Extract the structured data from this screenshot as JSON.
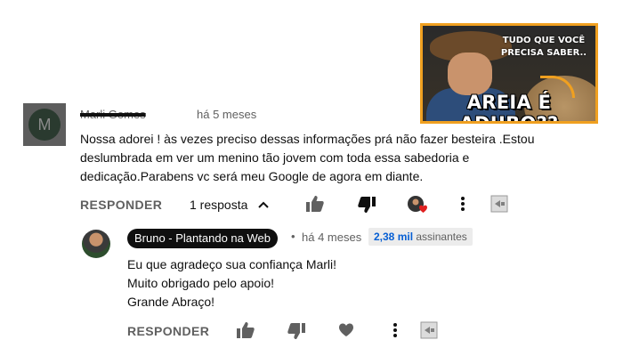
{
  "thumbnail": {
    "top_text_line1": "TUDO QUE VOCÊ",
    "top_text_line2": "PRECISA SABER..",
    "big_text": "AREIA É ADUBO??",
    "border_color": "#f0a020"
  },
  "comment": {
    "avatar_initial": "M",
    "author": "Marli Gomes",
    "time": "há 5 meses",
    "text_lines": [
      "Nossa adorei ! às vezes preciso dessas informações prá não fazer besteira .Estou",
      "deslumbrada em ver um menino tão jovem com toda essa sabedoria e",
      "dedicação.Parabens vc será meu Google de agora em diante."
    ],
    "reply_label": "RESPONDER",
    "replies_count_label": "1 resposta"
  },
  "reply": {
    "author": "Bruno - Plantando na Web",
    "separator": "•",
    "time": "há 4 meses",
    "subscribers_count": "2,38 mil",
    "subscribers_label": "assinantes",
    "text_lines": [
      "Eu que agradeço sua confiança Marli!",
      "Muito obrigado pelo apoio!",
      "Grande Abraço!"
    ],
    "reply_label": "RESPONDER"
  },
  "icons": {
    "like": "thumbs-up-icon",
    "dislike": "thumbs-down-icon",
    "creator_heart": "creator-heart-icon",
    "heart": "heart-icon",
    "more": "more-vert-icon",
    "extension": "extension-icon",
    "chevron": "chevron-up-icon"
  },
  "colors": {
    "text": "#0f0f0f",
    "secondary": "#606060",
    "link": "#065fd4",
    "heart_red": "#e02020"
  }
}
